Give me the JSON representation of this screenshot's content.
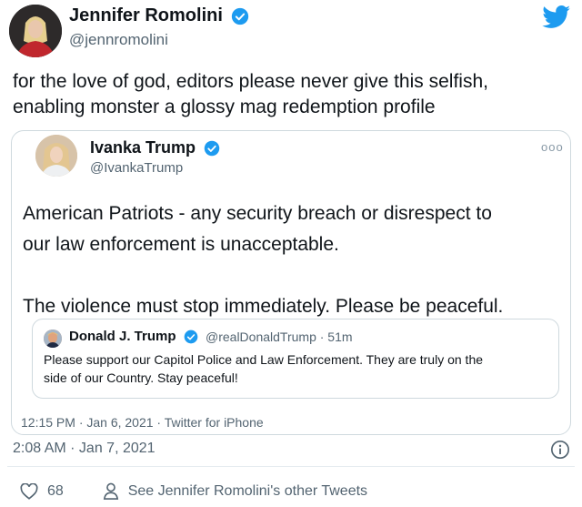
{
  "author": {
    "name": "Jennifer Romolini",
    "handle": "@jennromolini"
  },
  "tweet": {
    "text_line1": "for the love of god, editors please never give this selfish,",
    "text_line2": "enabling monster a glossy mag redemption profile",
    "timestamp": "2:08 AM · Jan 7, 2021",
    "likes": "68",
    "see_more": "See Jennifer Romolini's other Tweets"
  },
  "quoted": {
    "name": "Ivanka Trump",
    "handle": "@IvankaTrump",
    "body_line1": "American Patriots - any security breach or disrespect to",
    "body_line2": "our law enforcement is unacceptable.",
    "body_line3": "The violence must stop immediately. Please be peaceful.",
    "meta": "12:15 PM · Jan 6, 2021 · Twitter for iPhone",
    "more": "ooo"
  },
  "nested": {
    "name": "Donald J. Trump",
    "handle": "@realDonaldTrump · 51m",
    "body_line1": "Please support our Capitol Police and Law Enforcement. They are truly on the",
    "body_line2": "side of our Country. Stay peaceful!"
  },
  "colors": {
    "verified": "#1d9bf0",
    "twitter_blue": "#1d9bf0",
    "secondary_text": "#536471"
  }
}
